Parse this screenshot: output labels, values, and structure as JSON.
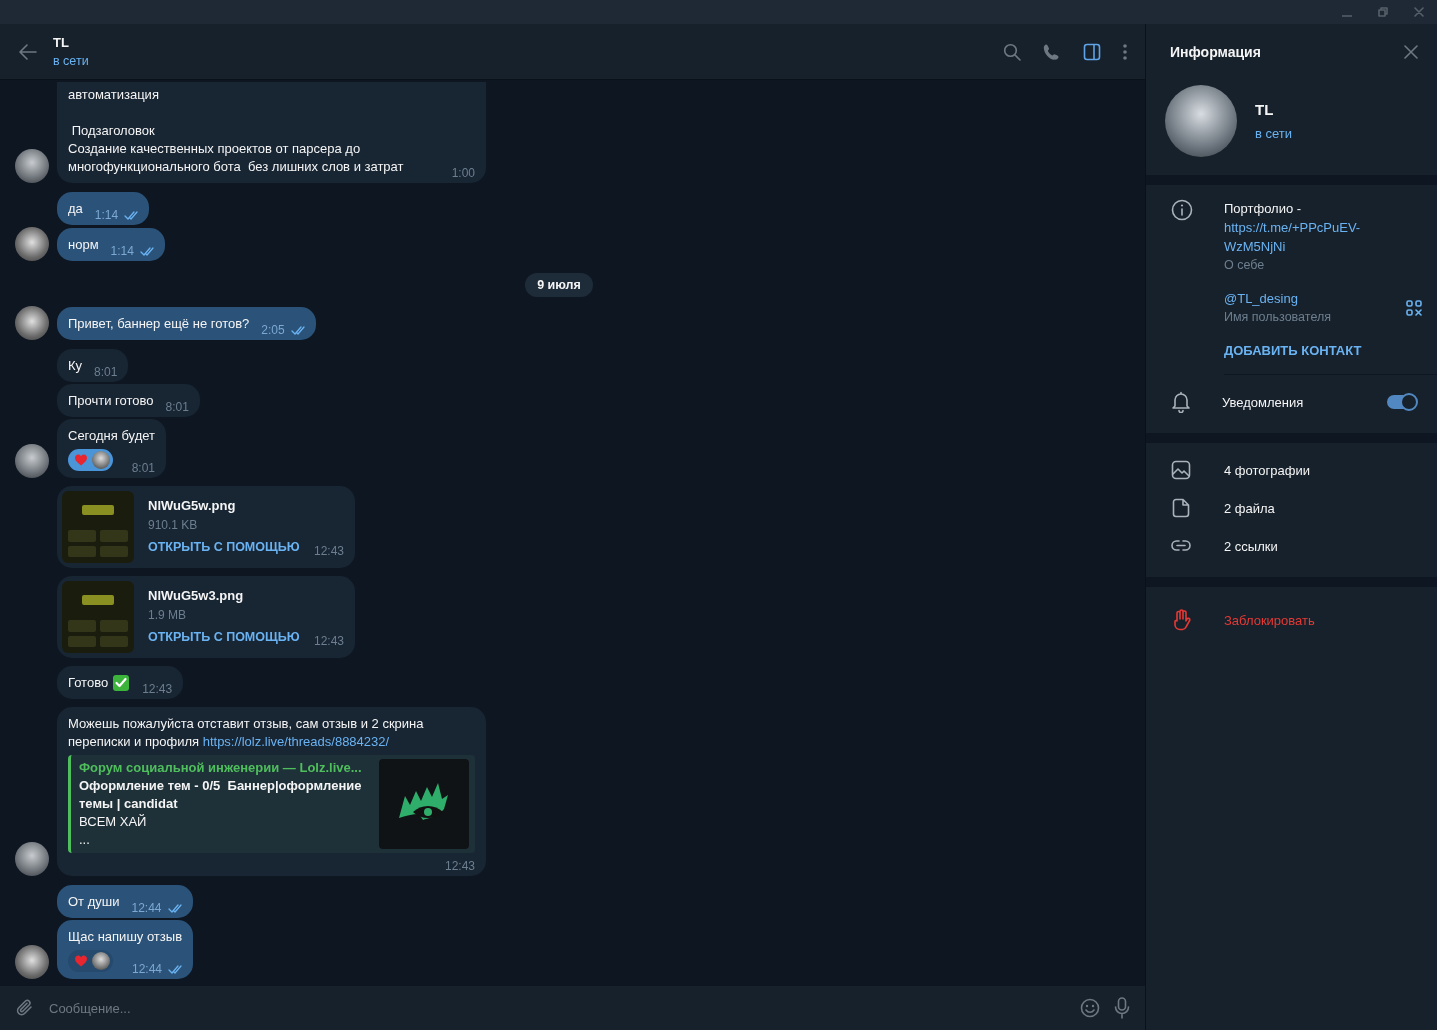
{
  "chat_header": {
    "name": "TL",
    "status": "в сети",
    "panel_toggle_active": true
  },
  "messages": [
    {
      "kind": "text",
      "outgoing": false,
      "cut_top": true,
      "avatar": true,
      "text": "автоматизация\n\n Подзаголовок\nСоздание качественных проектов от парсера до\nмногофункционального бота  без лишних слов и затрат",
      "time": "1:00"
    },
    {
      "kind": "text",
      "outgoing": true,
      "avatar": false,
      "text": "да",
      "time": "1:14",
      "read": true
    },
    {
      "kind": "text",
      "outgoing": true,
      "avatar": true,
      "text": "норм",
      "time": "1:14",
      "read": true
    },
    {
      "kind": "date",
      "text": "9 июля"
    },
    {
      "kind": "text",
      "outgoing": true,
      "avatar": true,
      "text": "Привет, баннер ещё не готов?",
      "time": "2:05",
      "read": true
    },
    {
      "kind": "text",
      "outgoing": false,
      "avatar": false,
      "text": "Ку",
      "time": "8:01"
    },
    {
      "kind": "text",
      "outgoing": false,
      "avatar": false,
      "text": "Прочти готово",
      "time": "8:01"
    },
    {
      "kind": "text",
      "outgoing": false,
      "avatar": true,
      "text": "Сегодня будет",
      "time": "8:01",
      "reaction": {
        "kind": "heart"
      }
    },
    {
      "kind": "file",
      "outgoing": false,
      "avatar": false,
      "name": "NlWuG5w.png",
      "size": "910.1 KB",
      "action": "ОТКРЫТЬ С ПОМОЩЬЮ",
      "time": "12:43"
    },
    {
      "kind": "file",
      "outgoing": false,
      "avatar": false,
      "name": "NlWuG5w3.png",
      "size": "1.9 MB",
      "action": "ОТКРЫТЬ С ПОМОЩЬЮ",
      "time": "12:43"
    },
    {
      "kind": "text",
      "outgoing": false,
      "avatar": false,
      "text": "Готово",
      "check_emoji": true,
      "time": "12:43"
    },
    {
      "kind": "link_preview",
      "outgoing": false,
      "avatar": true,
      "text": "Можешь пожалуйста отставит отзыв, сам отзыв и 2 скрина\nпереписки и профиля",
      "link": "https://lolz.live/threads/8884232/",
      "preview": {
        "site": "Форум социальной инженерии —  Lolz.live...",
        "title": "Оформление тем - 0/5  Баннер|оформление\nтемы | candidat",
        "description": "ВСЕМ ХАЙ\n..."
      },
      "time": "12:43"
    },
    {
      "kind": "text",
      "outgoing": true,
      "avatar": false,
      "text": "От души",
      "time": "12:44",
      "read": true
    },
    {
      "kind": "text",
      "outgoing": true,
      "avatar": true,
      "text": "Щас напишу отзыв",
      "time": "12:44",
      "read": true,
      "reaction": {
        "kind": "heart"
      }
    }
  ],
  "composer": {
    "placeholder": "Сообщение..."
  },
  "info_panel": {
    "title": "Информация",
    "name": "TL",
    "status": "в сети",
    "bio_prefix": "Портфолио -",
    "bio_link": "https://t.me/+PPcPuEV-WzM5NjNi",
    "bio_label": "О себе",
    "username": "@TL_desing",
    "username_label": "Имя пользователя",
    "add_contact": "ДОБАВИТЬ КОНТАКТ",
    "notifications": {
      "label": "Уведомления",
      "on": true
    },
    "media": [
      {
        "kind": "photos",
        "label": "4 фотографии"
      },
      {
        "kind": "files",
        "label": "2 файла"
      },
      {
        "kind": "links",
        "label": "2 ссылки"
      }
    ],
    "block": "Заблокировать"
  }
}
